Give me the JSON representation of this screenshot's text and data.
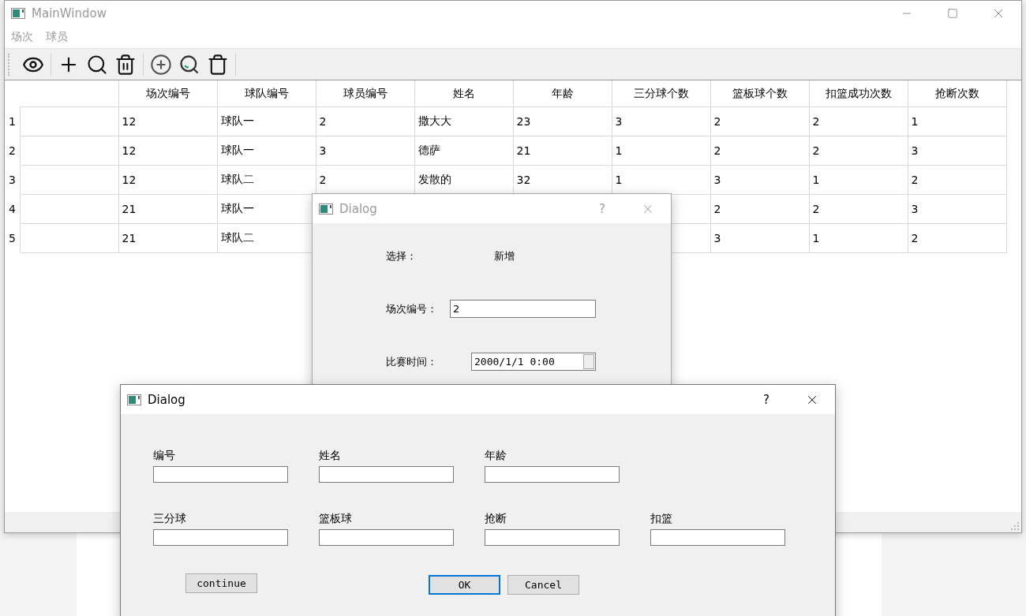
{
  "main_window": {
    "title": "MainWindow",
    "active": false,
    "menu": [
      "场次",
      "球员"
    ],
    "table": {
      "columns": [
        "场次编号",
        "球队编号",
        "球员编号",
        "姓名",
        "年龄",
        "三分球个数",
        "篮板球个数",
        "扣篮成功次数",
        "抢断次数"
      ],
      "rows": [
        {
          "number": "1",
          "cells": [
            "12",
            "球队一",
            "2",
            "撒大大",
            "23",
            "3",
            "2",
            "2",
            "1"
          ]
        },
        {
          "number": "2",
          "cells": [
            "12",
            "球队一",
            "3",
            "德萨",
            "21",
            "1",
            "2",
            "2",
            "3"
          ]
        },
        {
          "number": "3",
          "cells": [
            "12",
            "球队二",
            "2",
            "发散的",
            "32",
            "1",
            "3",
            "1",
            "2"
          ]
        },
        {
          "number": "4",
          "cells": [
            "21",
            "球队一",
            null,
            null,
            null,
            null,
            "2",
            "2",
            "3"
          ]
        },
        {
          "number": "5",
          "cells": [
            "21",
            "球队二",
            null,
            null,
            null,
            null,
            "3",
            "1",
            "2"
          ]
        }
      ]
    }
  },
  "match_dialog": {
    "title": "Dialog",
    "help": "?",
    "active": false,
    "fields": [
      {
        "kind": "static",
        "label": "选择：",
        "value": "新增"
      },
      {
        "kind": "text",
        "label": "场次编号：",
        "value": "2"
      },
      {
        "kind": "datetime",
        "label": "比赛时间：",
        "value": "2000/1/1 0:00"
      }
    ]
  },
  "player_dialog": {
    "title": "Dialog",
    "help": "?",
    "active": true,
    "field_rows": [
      [
        {
          "label": "编号"
        },
        {
          "label": "姓名"
        },
        {
          "label": "年龄"
        }
      ],
      [
        {
          "label": "三分球"
        },
        {
          "label": "篮板球"
        },
        {
          "label": "抢断"
        },
        {
          "label": "扣篮"
        }
      ]
    ],
    "buttons": [
      {
        "label": "continue",
        "default": false
      },
      {
        "label": "OK",
        "default": true
      },
      {
        "label": "Cancel",
        "default": false
      }
    ]
  }
}
